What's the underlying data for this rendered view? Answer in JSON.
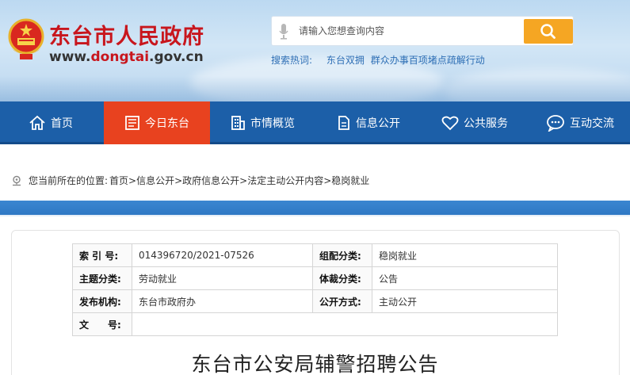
{
  "header": {
    "site_title": "东台市人民政府",
    "url_prefix": "www.",
    "url_highlight": "dongtai",
    "url_suffix": ".gov.cn"
  },
  "search": {
    "placeholder": "请输入您想查询内容",
    "hot_label": "搜索热词:",
    "hot_terms": [
      "东台双拥",
      "群众办事百项堵点疏解行动"
    ]
  },
  "nav": [
    {
      "label": "首页",
      "icon": "home-icon"
    },
    {
      "label": "今日东台",
      "icon": "newspaper-icon"
    },
    {
      "label": "市情概览",
      "icon": "building-icon"
    },
    {
      "label": "信息公开",
      "icon": "document-icon"
    },
    {
      "label": "公共服务",
      "icon": "heart-icon"
    },
    {
      "label": "互动交流",
      "icon": "chat-icon"
    }
  ],
  "nav_active": "今日东台",
  "breadcrumb": {
    "prefix": "您当前所在的位置:",
    "path": "首页>信息公开>政府信息公开>法定主动公开内容>稳岗就业"
  },
  "meta": {
    "index_label": "索 引 号:",
    "index_value": "014396720/2021-07526",
    "category_label": "组配分类:",
    "category_value": "稳岗就业",
    "topic_label": "主题分类:",
    "topic_value": "劳动就业",
    "genre_label": "体裁分类:",
    "genre_value": "公告",
    "publisher_label": "发布机构:",
    "publisher_value": "东台市政府办",
    "disclosure_label": "公开方式:",
    "disclosure_value": "主动公开",
    "docno_label": "文　　号:",
    "docno_value": ""
  },
  "article": {
    "title": "东台市公安局辅警招聘公告"
  },
  "colors": {
    "brand_red": "#c8161d",
    "nav_blue": "#1c5fa8",
    "nav_active": "#e8421f",
    "search_button": "#f5a623"
  }
}
